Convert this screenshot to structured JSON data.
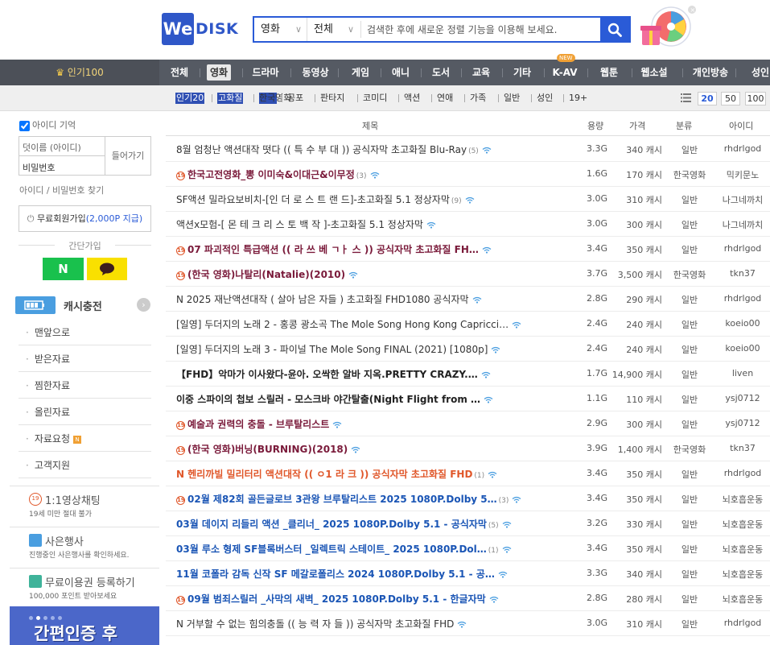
{
  "logo": {
    "we": "We",
    "disk": "DISK"
  },
  "search": {
    "category": "영화",
    "sub": "전체",
    "placeholder": "검색한 후에 새로운 정렬 기능을 이용해 보세요."
  },
  "nav": {
    "popular": "인기100",
    "items": [
      "전체",
      "영화",
      "드라마",
      "동영상",
      "게임",
      "애니",
      "도서",
      "교육",
      "기타",
      "K-AV",
      "웹툰",
      "웹소설",
      "개인방송",
      "성인"
    ],
    "new_badge": "NEW"
  },
  "subnav": {
    "items": [
      "인기20",
      "고화질",
      "한국영화",
      "공포",
      "판타지",
      "코미디",
      "액션",
      "연애",
      "가족",
      "일반",
      "성인",
      "19+"
    ],
    "page_sizes": [
      "20",
      "50",
      "100"
    ]
  },
  "login": {
    "remember": "아이디 기억",
    "id_placeholder": "덧이름 (아이디)",
    "pw_placeholder": "비밀번호",
    "login_button": "들어가기",
    "find": "아이디 / 비밀번호 찾기",
    "join": "무료회원가입",
    "join_point": "(2,000P 지급)",
    "easy_join": "간단가입",
    "naver": "N"
  },
  "cash": {
    "label": "캐시충전"
  },
  "menu": [
    "맨앞으로",
    "받은자료",
    "찜한자료",
    "올린자료",
    "자료요청",
    "고객지원"
  ],
  "request_badge": "N",
  "banners": [
    {
      "title": "1:1영상채팅",
      "sub": "19세 미만 절대 불가"
    },
    {
      "title": "사은행사",
      "sub": "진행중인 사은행사를 확인하세요."
    },
    {
      "title": "무료이용권 등록하기",
      "sub": "100,000 포인트 받아보세요"
    }
  ],
  "bottom_banner": "간편인증 후",
  "table": {
    "headers": {
      "title": "제목",
      "size": "용량",
      "price": "가격",
      "category": "분류",
      "id": "아이디"
    },
    "rows": [
      {
        "title": "8월 엄청난 액션대작 떳다 (( 특 수 부 대 )) 공식자막 초고화질 Blu-Ray",
        "count": "(5)",
        "size": "3.3G",
        "price": "340 캐시",
        "category": "일반",
        "user": "rhdrlgod",
        "style": "",
        "adult": false
      },
      {
        "title": "한국고전영화_뽕 이미숙&이대근&이무정",
        "count": "(3)",
        "size": "1.6G",
        "price": "170 캐시",
        "category": "한국영화",
        "user": "믹키문노",
        "style": "maroon",
        "adult": true
      },
      {
        "title": "SF액션 밀라요보비치-[인 더 로 스 트 랜 드]-초고화질 5.1 정상자막",
        "count": "(9)",
        "size": "3.0G",
        "price": "310 캐시",
        "category": "일반",
        "user": "나그네까치",
        "style": "",
        "adult": false
      },
      {
        "title": "액션x모험-[ 몬 테 크 리 스 토 백 작 ]-초고화질 5.1 정상자막",
        "count": "",
        "size": "3.0G",
        "price": "300 캐시",
        "category": "일반",
        "user": "나그네까치",
        "style": "",
        "adult": false
      },
      {
        "title": "07 파괴적인 특급액션 (( 라 쓰 베 ㄱㅏ 스 )) 공식자막 초고화질 FH…",
        "count": "",
        "size": "3.4G",
        "price": "350 캐시",
        "category": "일반",
        "user": "rhdrlgod",
        "style": "maroon",
        "adult": true
      },
      {
        "title": "(한국 영화)나탈리(Natalie)(2010)",
        "count": "",
        "size": "3.7G",
        "price": "3,500 캐시",
        "category": "한국영화",
        "user": "tkn37",
        "style": "maroon",
        "adult": true
      },
      {
        "title": "N 2025 재난액션대작 ( 살아 남은 자들 ) 초고화질 FHD1080 공식자막",
        "count": "",
        "size": "2.8G",
        "price": "290 캐시",
        "category": "일반",
        "user": "rhdrlgod",
        "style": "",
        "adult": false
      },
      {
        "title": "[일영] 두더지의 노래 2 - 홍콩 광소곡 The Mole Song Hong Kong Capricci…",
        "count": "",
        "size": "2.4G",
        "price": "240 캐시",
        "category": "일반",
        "user": "koeio00",
        "style": "",
        "adult": false
      },
      {
        "title": "[일영] 두더지의 노래 3 - 파이널 The Mole Song FINAL (2021) [1080p]",
        "count": "",
        "size": "2.4G",
        "price": "240 캐시",
        "category": "일반",
        "user": "koeio00",
        "style": "",
        "adult": false
      },
      {
        "title": "【FHD】악마가 이사왔다-윤아. 오싹한 알바 지옥.PRETTY CRAZY.…",
        "count": "",
        "size": "1.7G",
        "price": "14,900 캐시",
        "category": "일반",
        "user": "liven",
        "style": "b",
        "adult": false
      },
      {
        "title": "이중 스파이의 첩보 스릴러 - 모스크바 야간탈출(Night Flight from …",
        "count": "",
        "size": "1.1G",
        "price": "110 캐시",
        "category": "일반",
        "user": "ysj0712",
        "style": "b",
        "adult": false
      },
      {
        "title": "예술과 권력의 충돌 - 브루탈리스트",
        "count": "",
        "size": "2.9G",
        "price": "300 캐시",
        "category": "일반",
        "user": "ysj0712",
        "style": "maroon",
        "adult": true
      },
      {
        "title": "(한국 영화)버닝(BURNING)(2018)",
        "count": "",
        "size": "3.9G",
        "price": "1,400 캐시",
        "category": "한국영화",
        "user": "tkn37",
        "style": "maroon",
        "adult": true
      },
      {
        "title": "N 헨리까빌 밀리터리 액션대작 (( ㅇ1 라 크 )) 공식자막 초고화질 FHD",
        "count": "(1)",
        "size": "3.4G",
        "price": "350 캐시",
        "category": "일반",
        "user": "rhdrlgod",
        "style": "orange",
        "adult": false
      },
      {
        "title": "02월 제82회 골든글로브 3관왕 브루탈리스트 2025 1080P.Dolby 5…",
        "count": "(3)",
        "size": "3.4G",
        "price": "350 캐시",
        "category": "일반",
        "user": "뇌호흡운동",
        "style": "blue",
        "adult": true
      },
      {
        "title": "03월 데이지 리들리 액션 _클리너_ 2025 1080P.Dolby 5.1 - 공식자막",
        "count": "(5)",
        "size": "3.2G",
        "price": "330 캐시",
        "category": "일반",
        "user": "뇌호흡운동",
        "style": "blue",
        "adult": false
      },
      {
        "title": "03월 루소 형제 SF블록버스터 _일렉트릭 스테이트_ 2025 1080P.Dol…",
        "count": "(1)",
        "size": "3.4G",
        "price": "350 캐시",
        "category": "일반",
        "user": "뇌호흡운동",
        "style": "blue",
        "adult": false
      },
      {
        "title": "11월 코폴라 감독 신작 SF 메갈로폴리스 2024 1080P.Dolby 5.1 - 공…",
        "count": "",
        "size": "3.3G",
        "price": "340 캐시",
        "category": "일반",
        "user": "뇌호흡운동",
        "style": "blue",
        "adult": false
      },
      {
        "title": "09월 범죄스릴러 _사막의 새벽_ 2025 1080P.Dolby 5.1 - 한글자막",
        "count": "",
        "size": "2.8G",
        "price": "280 캐시",
        "category": "일반",
        "user": "뇌호흡운동",
        "style": "blue",
        "adult": true
      },
      {
        "title": "N 거부할 수 없는 힘의충돌 (( 능 력 자 들 )) 공식자막 초고화질 FHD",
        "count": "",
        "size": "3.0G",
        "price": "310 캐시",
        "category": "일반",
        "user": "rhdrlgod",
        "style": "",
        "adult": false
      }
    ]
  },
  "adult_badge": "19",
  "colors": {
    "accent": "#2a5bd7",
    "nav_bg": "#555a63",
    "maroon": "#7a1a3a",
    "blue": "#1a55b5",
    "orange": "#e0572a"
  }
}
